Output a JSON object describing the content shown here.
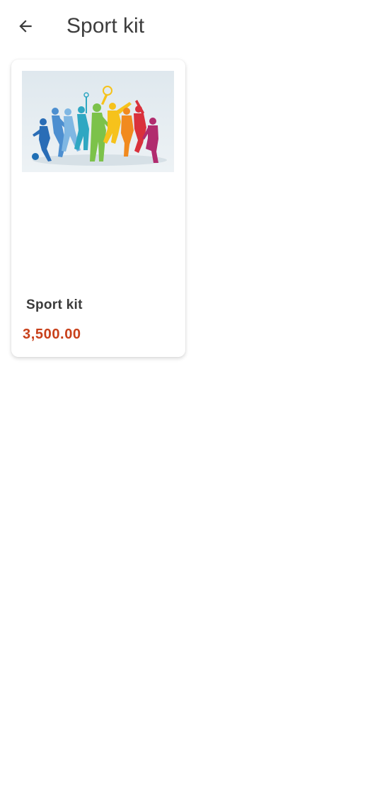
{
  "header": {
    "title": "Sport kit",
    "back_icon": "arrow-left-icon"
  },
  "products": [
    {
      "name": "Sport kit",
      "price": "3,500.00",
      "price_color": "#c8401a",
      "image_icon": "sports-silhouettes-image"
    }
  ]
}
